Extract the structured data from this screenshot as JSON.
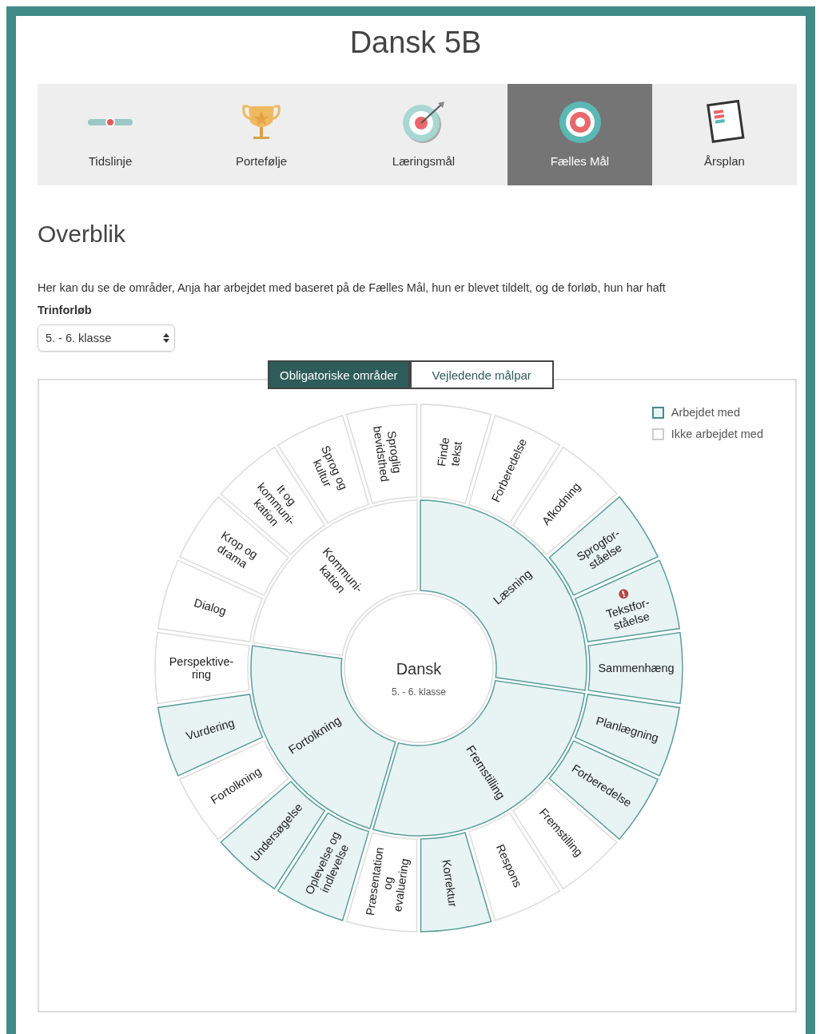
{
  "page": {
    "title": "Dansk 5B"
  },
  "tabs": [
    {
      "label": "Tidslinje",
      "kind": "timeline",
      "selected": false
    },
    {
      "label": "Portefølje",
      "kind": "trophy",
      "selected": false
    },
    {
      "label": "Læringsmål",
      "kind": "dart",
      "selected": false
    },
    {
      "label": "Fælles Mål",
      "kind": "target",
      "selected": true
    },
    {
      "label": "Årsplan",
      "kind": "notebook",
      "selected": false
    }
  ],
  "section": {
    "heading": "Overblik",
    "description": "Her kan du se de områder, Anja har arbejdet med baseret på de Fælles Mål, hun er blevet tildelt, og de forløb, hun har haft",
    "select_label": "Trinforløb",
    "select_value": "5. - 6. klasse"
  },
  "view_toggle": [
    {
      "label": "Obligatoriske områder",
      "selected": true
    },
    {
      "label": "Vejledende målpar",
      "selected": false
    }
  ],
  "legend": [
    {
      "label": "Arbejdet med",
      "worked": true
    },
    {
      "label": "Ikke arbejdet med",
      "worked": false
    }
  ],
  "wheel": {
    "center_title": "Dansk",
    "center_subtitle": "5. - 6. klasse",
    "areas": [
      {
        "label": "Læsning",
        "worked": true,
        "children": [
          {
            "label": "Finde\ntekst",
            "worked": false,
            "warning": false
          },
          {
            "label": "Forberedelse",
            "worked": false,
            "warning": false
          },
          {
            "label": "Afkodning",
            "worked": false,
            "warning": false
          },
          {
            "label": "Sprogfor-\nståelse",
            "worked": true,
            "warning": false
          },
          {
            "label": "Tekstfor-\nståelse",
            "worked": true,
            "warning": true
          },
          {
            "label": "Sammenhæng",
            "worked": true,
            "warning": false
          }
        ]
      },
      {
        "label": "Fremstilling",
        "worked": true,
        "children": [
          {
            "label": "Planlægning",
            "worked": true,
            "warning": false
          },
          {
            "label": "Forberedelse",
            "worked": true,
            "warning": false
          },
          {
            "label": "Fremstilling",
            "worked": false,
            "warning": false
          },
          {
            "label": "Respons",
            "worked": false,
            "warning": false
          },
          {
            "label": "Korrektur",
            "worked": true,
            "warning": false
          },
          {
            "label": "Præsentation\nog\nevaluering",
            "worked": false,
            "warning": false
          }
        ]
      },
      {
        "label": "Fortolkning",
        "worked": true,
        "children": [
          {
            "label": "Oplevelse og\nindlevelse",
            "worked": true,
            "warning": false
          },
          {
            "label": "Undersøgelse",
            "worked": true,
            "warning": false
          },
          {
            "label": "Fortolkning",
            "worked": false,
            "warning": false
          },
          {
            "label": "Vurdering",
            "worked": true,
            "warning": false
          },
          {
            "label": "Perspektive-\nring",
            "worked": false,
            "warning": false
          }
        ]
      },
      {
        "label": "Kommuni-\nkation",
        "worked": false,
        "children": [
          {
            "label": "Dialog",
            "worked": false,
            "warning": false
          },
          {
            "label": "Krop og\ndrama",
            "worked": false,
            "warning": false
          },
          {
            "label": "It og\nkommuni-\nkation",
            "worked": false,
            "warning": false
          },
          {
            "label": "Sprog og\nkultur",
            "worked": false,
            "warning": false
          },
          {
            "label": "Sproglig\nbevidsthed",
            "worked": false,
            "warning": false
          }
        ]
      }
    ]
  }
}
